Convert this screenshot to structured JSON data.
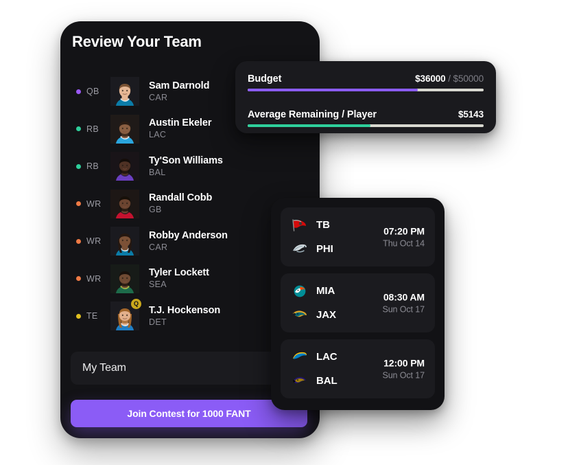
{
  "app": {
    "accent_purple": "#8b5cf6",
    "accent_green": "#2ecf9b",
    "card_bg": "#131316",
    "row_bg": "#1b1b1f"
  },
  "team_card": {
    "title": "Review Your Team",
    "roster": [
      {
        "position": "QB",
        "dot_color": "#9b59f6",
        "name": "Sam Darnold",
        "team": "CAR",
        "avatar": "sam-darnold",
        "badge": ""
      },
      {
        "position": "RB",
        "dot_color": "#2ecf9b",
        "name": "Austin Ekeler",
        "team": "LAC",
        "avatar": "austin-ekeler",
        "badge": ""
      },
      {
        "position": "RB",
        "dot_color": "#2ecf9b",
        "name": "Ty'Son Williams",
        "team": "BAL",
        "avatar": "tyson-williams",
        "badge": ""
      },
      {
        "position": "WR",
        "dot_color": "#ef7a45",
        "name": "Randall Cobb",
        "team": "GB",
        "avatar": "randall-cobb",
        "badge": ""
      },
      {
        "position": "WR",
        "dot_color": "#ef7a45",
        "name": "Robby Anderson",
        "team": "CAR",
        "avatar": "robby-anderson",
        "badge": ""
      },
      {
        "position": "WR",
        "dot_color": "#ef7a45",
        "name": "Tyler Lockett",
        "team": "SEA",
        "avatar": "tyler-lockett",
        "badge": ""
      },
      {
        "position": "TE",
        "dot_color": "#e0c020",
        "name": "T.J. Hockenson",
        "team": "DET",
        "avatar": "tj-hockenson",
        "badge": "Q"
      }
    ],
    "team_name_input": {
      "value": "My Team",
      "placeholder": "My Team"
    },
    "join_button_label": "Join Contest for 1000 FANT"
  },
  "budget_card": {
    "meters": [
      {
        "label": "Budget",
        "value_primary": "$36000",
        "value_separator": " / ",
        "value_secondary": "$50000",
        "fill_percent": 72,
        "fill_color": "#8b5cf6"
      },
      {
        "label": "Average Remaining / Player",
        "value_primary": "$5143",
        "value_separator": "",
        "value_secondary": "",
        "fill_percent": 52,
        "fill_color": "#2ecf9b"
      }
    ]
  },
  "games_card": {
    "games": [
      {
        "away": {
          "abbr": "TB",
          "logo": "buccaneers-logo"
        },
        "home": {
          "abbr": "PHI",
          "logo": "eagles-logo"
        },
        "time": "07:20 PM",
        "date": "Thu Oct 14"
      },
      {
        "away": {
          "abbr": "MIA",
          "logo": "dolphins-logo"
        },
        "home": {
          "abbr": "JAX",
          "logo": "jaguars-logo"
        },
        "time": "08:30 AM",
        "date": "Sun Oct 17"
      },
      {
        "away": {
          "abbr": "LAC",
          "logo": "chargers-logo"
        },
        "home": {
          "abbr": "BAL",
          "logo": "ravens-logo"
        },
        "time": "12:00 PM",
        "date": "Sun Oct 17"
      }
    ]
  }
}
